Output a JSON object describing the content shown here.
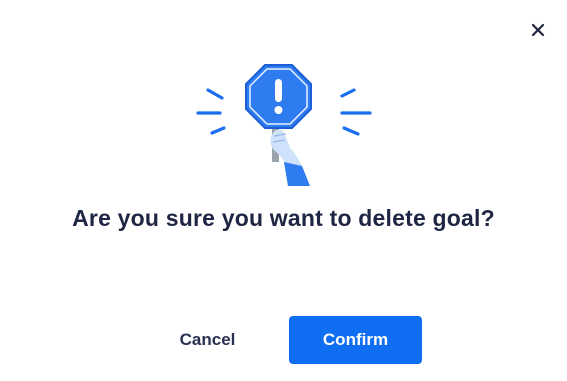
{
  "dialog": {
    "title": "Are you sure you want to delete goal?",
    "close_icon": "close-icon",
    "illustration_icon": "warning-stop-sign-icon",
    "buttons": {
      "cancel_label": "Cancel",
      "confirm_label": "Confirm"
    }
  },
  "colors": {
    "accent": "#0f6ef2",
    "title_text": "#1f2643",
    "secondary_text": "#2a3150",
    "sign_blue": "#2f7cf0",
    "hand_light_blue": "#cfe1fb"
  }
}
